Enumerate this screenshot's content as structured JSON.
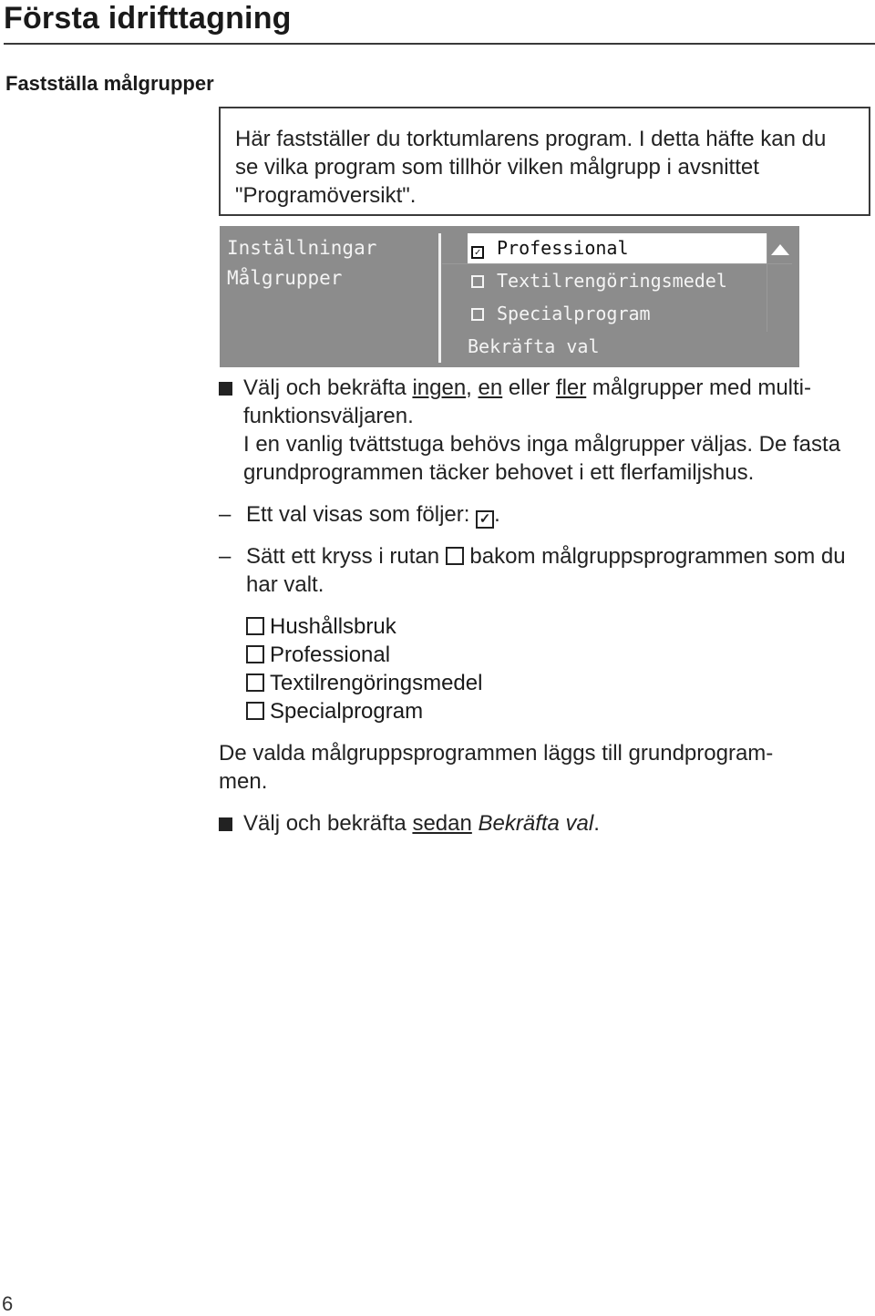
{
  "header": {
    "title": "Första idrifttagning",
    "section": "Fastställa målgrupper"
  },
  "info_box": {
    "text": "Här fastställer du torktumlarens program. I detta häfte kan du se vilka program som tillhör vilken målgrupp i avsnittet \"Programöversikt\"."
  },
  "display": {
    "menu_path": [
      "Inställningar",
      "Målgrupper"
    ],
    "items": [
      {
        "label": "Professional",
        "checked": true,
        "highlighted": true
      },
      {
        "label": "Textilrengöringsmedel",
        "checked": false,
        "highlighted": false
      },
      {
        "label": "Specialprogram",
        "checked": false,
        "highlighted": false
      }
    ],
    "confirm_label": "Bekräfta val",
    "scroll_icon": "triangle-up-icon",
    "colors": {
      "background": "#8c8c8c",
      "highlight": "#ffffff",
      "text": "#f4f4f4"
    }
  },
  "instructions": {
    "step1": {
      "pre": "Välj och bekräfta ",
      "u1": "ingen",
      "sep1": ", ",
      "u2": "en",
      "sep2": " eller ",
      "u3": "fler",
      "post": " målgrupper med multi-funktionsväljaren.",
      "line1_post": " målgrupper med multi-",
      "line2": "funktionsväljaren.",
      "note": "I en vanlig tvättstuga behövs inga målgrupper väljas. De fasta grundprogrammen täcker behovet i ett flerfamiljshus."
    },
    "dash1": {
      "text": "Ett val visas som följer: ",
      "symbol": "✓",
      "end": "."
    },
    "dash2": {
      "pre": "Sätt ett kryss i rutan ",
      "post": " bakom målgruppsprogrammen som du har valt."
    },
    "checkbox_list": [
      "Hushållsbruk",
      "Professional",
      "Textilrengöringsmedel",
      "Specialprogram"
    ],
    "summary": "De valda målgruppsprogrammen läggs till grundprogram-men.",
    "summary_line1": "De valda målgruppsprogrammen läggs till grundprogram-",
    "summary_line2": "men.",
    "step2": {
      "pre": "Välj och bekräfta ",
      "u": "sedan",
      "italic": "Bekräfta val",
      "end": "."
    }
  },
  "footer": {
    "page_number": "6"
  }
}
